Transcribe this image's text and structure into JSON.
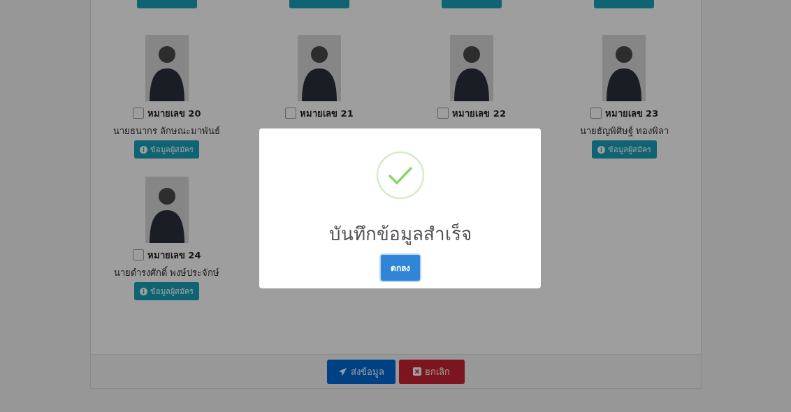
{
  "candidates": [
    {
      "number": "หมายเลข 20",
      "checked": false,
      "name": "นายธนากร ลักษณะมาพันธ์",
      "button": "ข้อมูลผู้สมัคร"
    },
    {
      "number": "หมายเลข 21",
      "checked": false
    },
    {
      "number": "หมายเลข 22",
      "checked": false
    },
    {
      "number": "หมายเลข 23",
      "checked": false,
      "name": "นายธัญพิศิษฐ์ ทองพิลา",
      "button": "ข้อมูลผู้สมัคร"
    },
    {
      "number": "หมายเลข 24",
      "checked": false,
      "name": "นายดำรงศักดิ์ พงษ์ประจักษ์",
      "button": "ข้อมูลผู้สมัคร"
    }
  ],
  "footer": {
    "submit": "ส่งข้อมูล",
    "cancel": "ยกเลิก"
  },
  "dialog": {
    "title": "บันทึกข้อมูลสำเร็จ",
    "button": "ตกลง"
  }
}
